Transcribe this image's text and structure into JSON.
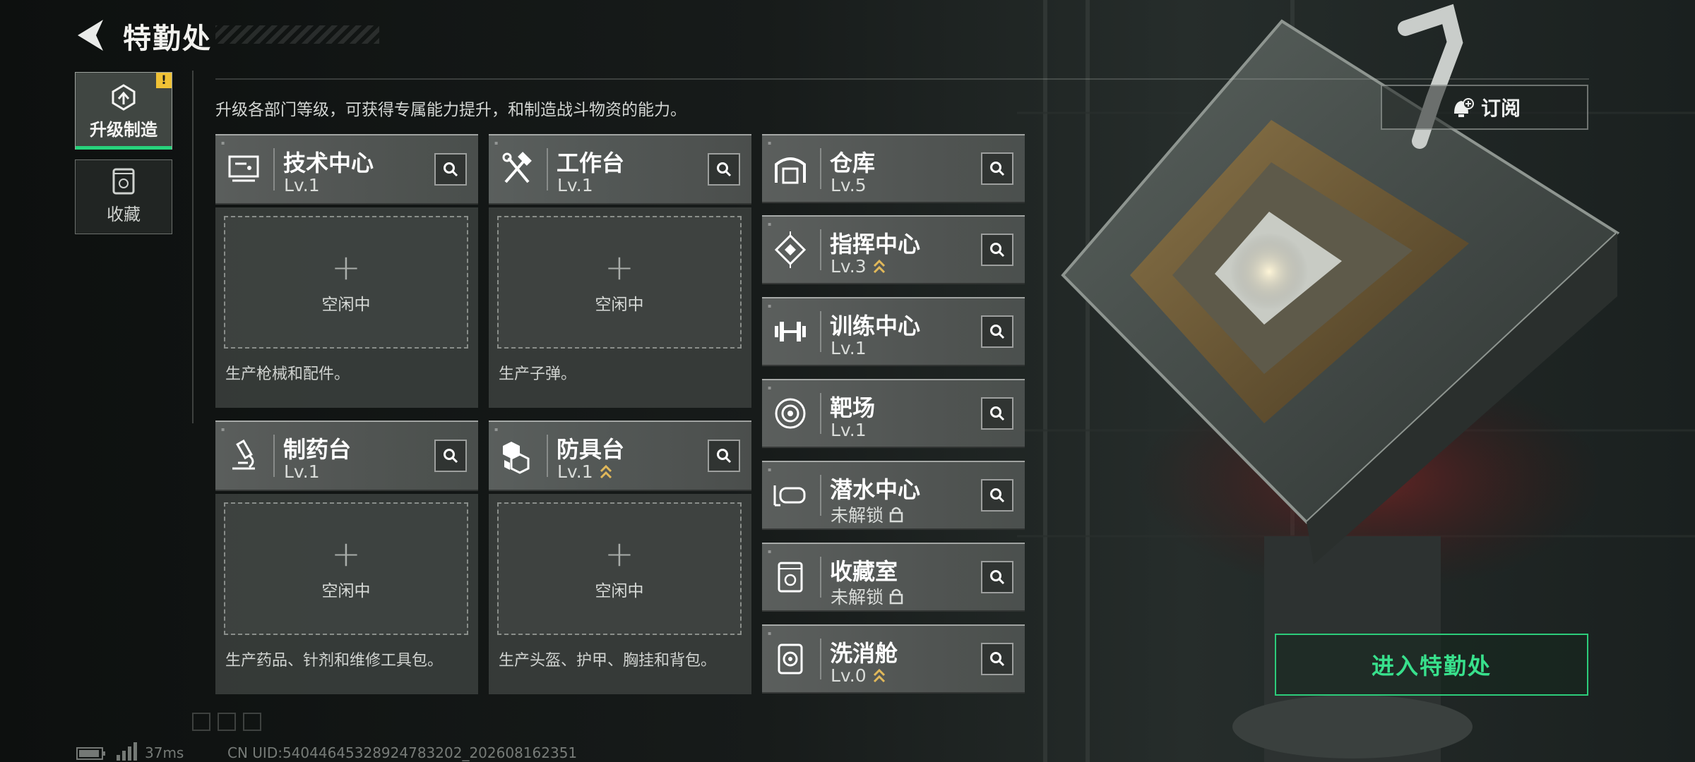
{
  "header": {
    "title": "特勤处"
  },
  "sidebar": {
    "tabs": [
      {
        "label": "升级制造",
        "active": true,
        "alert": "!"
      },
      {
        "label": "收藏",
        "active": false
      }
    ]
  },
  "description": "升级各部门等级，可获得专属能力提升，和制造战斗物资的能力。",
  "subscribe": {
    "label": "订阅"
  },
  "production": [
    {
      "name": "技术中心",
      "level": "Lv.1",
      "slot_label": "空闲中",
      "plus": "+",
      "desc": "生产枪械和配件。"
    },
    {
      "name": "工作台",
      "level": "Lv.1",
      "slot_label": "空闲中",
      "plus": "+",
      "desc": "生产子弹。"
    },
    {
      "name": "制药台",
      "level": "Lv.1",
      "slot_label": "空闲中",
      "plus": "+",
      "desc": "生产药品、针剂和维修工具包。"
    },
    {
      "name": "防具台",
      "level": "Lv.1",
      "slot_label": "空闲中",
      "plus": "+",
      "desc": "生产头盔、护甲、胸挂和背包。"
    }
  ],
  "facilities": [
    {
      "name": "仓库",
      "level": "Lv.5"
    },
    {
      "name": "指挥中心",
      "level": "Lv.3"
    },
    {
      "name": "训练中心",
      "level": "Lv.1"
    },
    {
      "name": "靶场",
      "level": "Lv.1"
    },
    {
      "name": "潜水中心",
      "level": "未解锁"
    },
    {
      "name": "收藏室",
      "level": "未解锁"
    },
    {
      "name": "洗消舱",
      "level": "Lv.0"
    }
  ],
  "enter_button": {
    "label": "进入特勤处"
  },
  "footer": {
    "latency": "37ms",
    "uid": "CN UID:54044645328924783202_202608162351"
  },
  "colors": {
    "accent_green": "#2ccc7a",
    "alert_yellow": "#f0c236",
    "upgrade_arrow": "#e0b85a"
  }
}
